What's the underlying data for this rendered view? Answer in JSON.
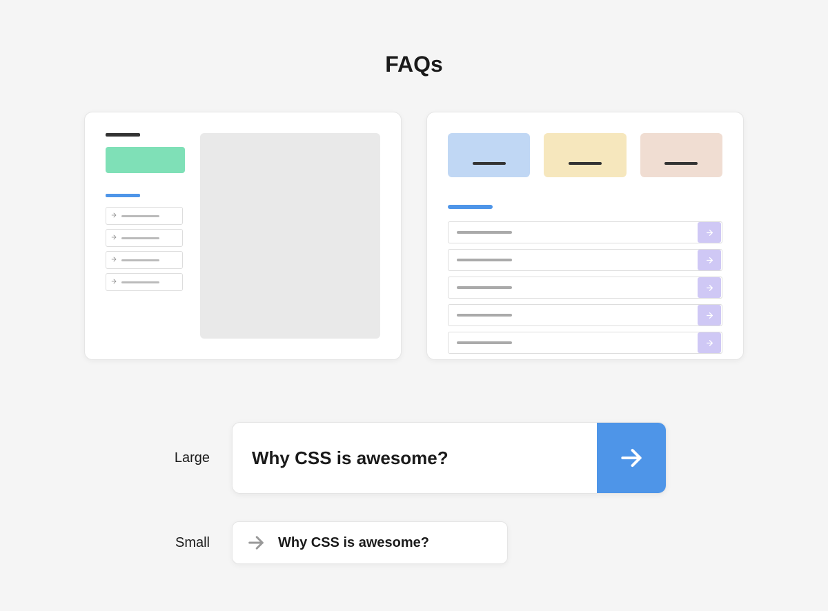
{
  "title": "FAQs",
  "card1": {
    "sidebar_items_count": 4
  },
  "card2": {
    "tab_colors": [
      "blue",
      "yellow",
      "pink"
    ],
    "items_count": 5
  },
  "examples": {
    "large": {
      "label": "Large",
      "question": "Why CSS is awesome?"
    },
    "small": {
      "label": "Small",
      "question": "Why CSS is awesome?"
    }
  }
}
